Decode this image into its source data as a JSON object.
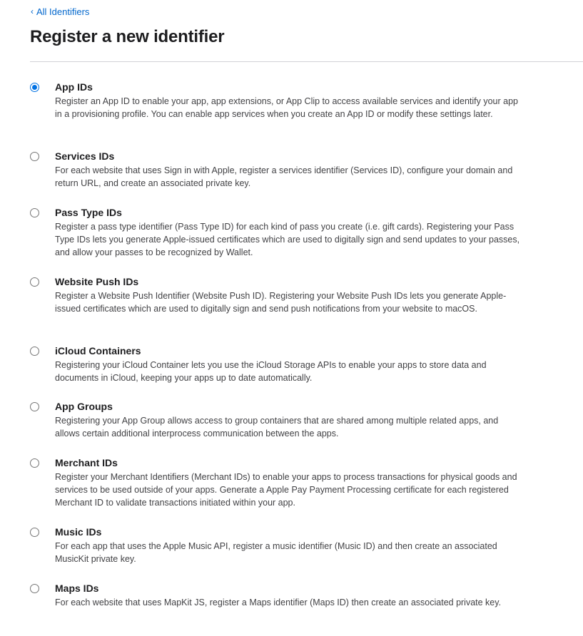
{
  "nav": {
    "back_chevron": "‹",
    "back_label": "All Identifiers"
  },
  "header": {
    "title": "Register a new identifier"
  },
  "options": [
    {
      "title": "App IDs",
      "selected": true,
      "description": "Register an App ID to enable your app, app extensions, or App Clip to access available services and identify your app in a provisioning profile. You can enable app services when you create an App ID or modify these settings later."
    },
    {
      "title": "Services IDs",
      "selected": false,
      "description": "For each website that uses Sign in with Apple, register a services identifier (Services ID), configure your domain and return URL, and create an associated private key."
    },
    {
      "title": "Pass Type IDs",
      "selected": false,
      "description": "Register a pass type identifier (Pass Type ID) for each kind of pass you create (i.e. gift cards). Registering your Pass Type IDs lets you generate Apple-issued certificates which are used to digitally sign and send updates to your passes, and allow your passes to be recognized by Wallet."
    },
    {
      "title": "Website Push IDs",
      "selected": false,
      "description": "Register a Website Push Identifier (Website Push ID). Registering your Website Push IDs lets you generate Apple-issued certificates which are used to digitally sign and send push notifications from your website to macOS."
    },
    {
      "title": "iCloud Containers",
      "selected": false,
      "description": "Registering your iCloud Container lets you use the iCloud Storage APIs to enable your apps to store data and documents in iCloud, keeping your apps up to date automatically."
    },
    {
      "title": "App Groups",
      "selected": false,
      "description": "Registering your App Group allows access to group containers that are shared among multiple related apps, and allows certain additional interprocess communication between the apps."
    },
    {
      "title": "Merchant IDs",
      "selected": false,
      "description": "Register your Merchant Identifiers (Merchant IDs) to enable your apps to process transactions for physical goods and services to be used outside of your apps. Generate a Apple Pay Payment Processing certificate for each registered Merchant ID to validate transactions initiated within your app."
    },
    {
      "title": "Music IDs",
      "selected": false,
      "description": "For each app that uses the Apple Music API, register a music identifier (Music ID) and then create an associated MusicKit private key."
    },
    {
      "title": "Maps IDs",
      "selected": false,
      "description": "For each website that uses MapKit JS, register a Maps identifier (Maps ID) then create an associated private key."
    }
  ],
  "colors": {
    "link": "#0066cc",
    "radio_selected": "#0071e3",
    "title_text": "#1d1d1f",
    "body_text": "#424245",
    "divider": "#d2d2d7"
  }
}
